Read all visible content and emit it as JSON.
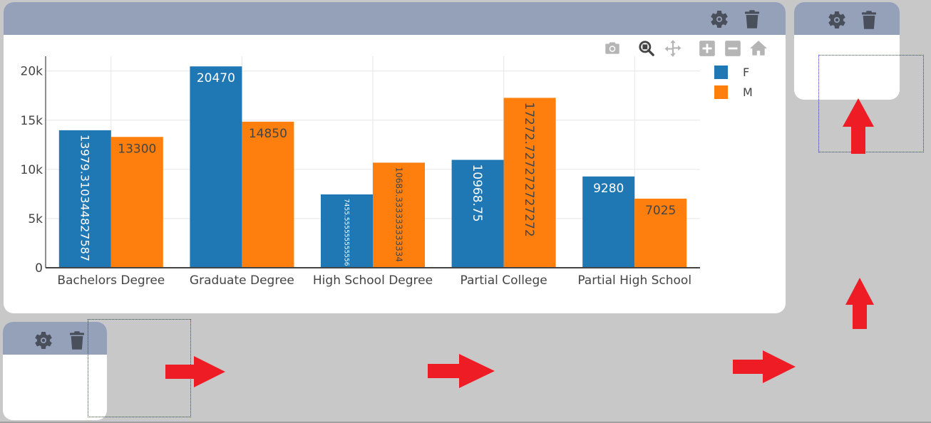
{
  "colors": {
    "panel_header": "#95a1b9",
    "series_F": "#1f77b4",
    "series_M": "#ff7f0e",
    "arrow": "#ee1c25",
    "icon": "#4a4f5c",
    "modebar_icon": "#b5b5b5"
  },
  "panels": [
    {
      "name": "main",
      "header_icons": [
        "gear-icon",
        "trash-icon"
      ]
    },
    {
      "name": "right",
      "header_icons": [
        "gear-icon",
        "trash-icon"
      ]
    },
    {
      "name": "bottom",
      "header_icons": [
        "gear-icon",
        "trash-icon"
      ]
    }
  ],
  "modebar": [
    "camera-icon",
    "zoom-icon",
    "pan-icon",
    "zoom-in-icon",
    "zoom-out-icon",
    "home-icon"
  ],
  "arrows": [
    "arrow-up-1",
    "arrow-up-2",
    "arrow-right-1",
    "arrow-right-2",
    "arrow-right-3"
  ],
  "chart_data": {
    "type": "bar",
    "categories": [
      "Bachelors Degree",
      "Graduate Degree",
      "High School Degree",
      "Partial College",
      "Partial High School"
    ],
    "series": [
      {
        "name": "F",
        "values": [
          13979.310344827587,
          20470,
          7455.555555555556,
          10968.75,
          9280
        ],
        "labels": [
          "13979.310344827587",
          "20470",
          "7455.555555555556",
          "10968.75",
          "9280"
        ]
      },
      {
        "name": "M",
        "values": [
          13300,
          14850,
          10683.333333333334,
          17272.727272727272,
          7025
        ],
        "labels": [
          "13300",
          "14850",
          "10683.333333333334",
          "17272.727272727272",
          "7025"
        ]
      }
    ],
    "ylim": [
      0,
      21500
    ],
    "yticks": [
      0,
      5000,
      10000,
      15000,
      20000
    ],
    "ytick_labels": [
      "0",
      "5k",
      "10k",
      "15k",
      "20k"
    ],
    "grid": true,
    "legend_position": "top-right",
    "title": "",
    "xlabel": "",
    "ylabel": ""
  }
}
